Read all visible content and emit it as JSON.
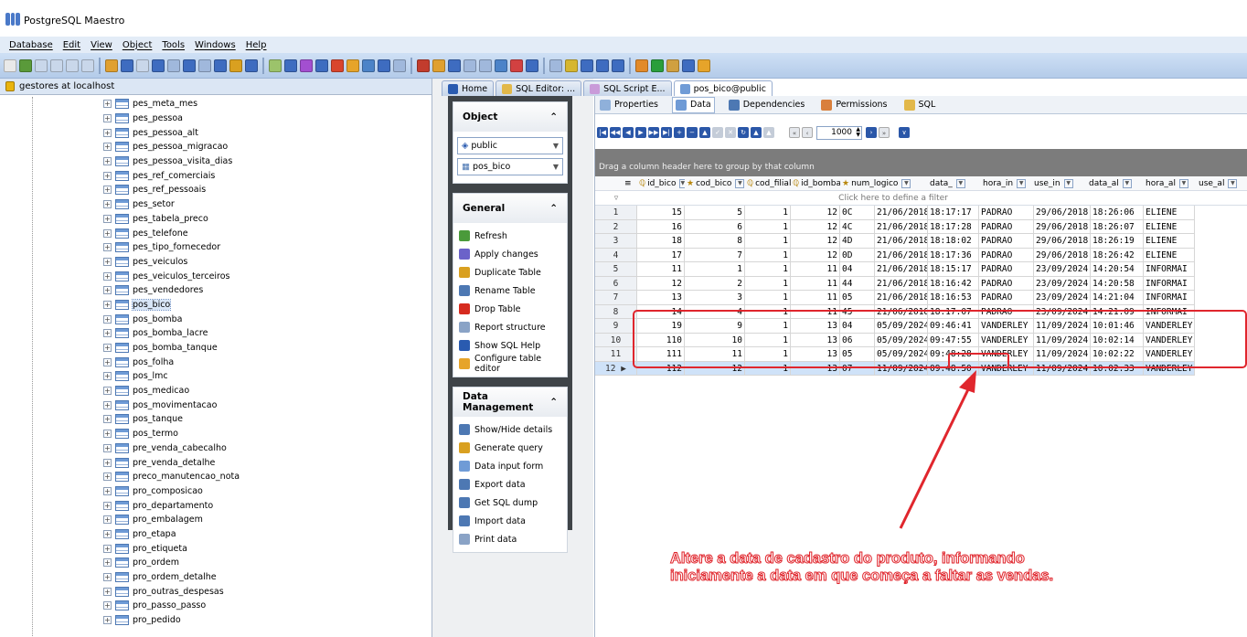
{
  "app": {
    "title": "PostgreSQL Maestro"
  },
  "menu": [
    "Database",
    "Edit",
    "View",
    "Object",
    "Tools",
    "Windows",
    "Help"
  ],
  "explorer": {
    "connection": "gestores at localhost",
    "tables": [
      "pes_meta_mes",
      "pes_pessoa",
      "pes_pessoa_alt",
      "pes_pessoa_migracao",
      "pes_pessoa_visita_dias",
      "pes_ref_comerciais",
      "pes_ref_pessoais",
      "pes_setor",
      "pes_tabela_preco",
      "pes_telefone",
      "pes_tipo_fornecedor",
      "pes_veiculos",
      "pes_veiculos_terceiros",
      "pes_vendedores",
      "pos_bico",
      "pos_bomba",
      "pos_bomba_lacre",
      "pos_bomba_tanque",
      "pos_folha",
      "pos_lmc",
      "pos_medicao",
      "pos_movimentacao",
      "pos_tanque",
      "pos_termo",
      "pre_venda_cabecalho",
      "pre_venda_detalhe",
      "preco_manutencao_nota",
      "pro_composicao",
      "pro_departamento",
      "pro_embalagem",
      "pro_etapa",
      "pro_etiqueta",
      "pro_ordem",
      "pro_ordem_detalhe",
      "pro_outras_despesas",
      "pro_passo_passo",
      "pro_pedido"
    ],
    "selected": "pos_bico"
  },
  "tabs": [
    "Home",
    "SQL Editor: ...",
    "SQL Script E...",
    "pos_bico@public"
  ],
  "object_panel": {
    "object_title": "Object",
    "schema": "public",
    "table": "pos_bico",
    "general_title": "General",
    "general_actions": [
      "Refresh",
      "Apply changes",
      "Duplicate Table",
      "Rename Table",
      "Drop Table",
      "Report structure",
      "Show SQL Help",
      "Configure table editor"
    ],
    "data_title": "Data Management",
    "data_actions": [
      "Show/Hide details",
      "Generate query",
      "Data input form",
      "Export data",
      "Get SQL dump",
      "Import data",
      "Print data"
    ]
  },
  "subtabs": [
    "Properties",
    "Data",
    "Dependencies",
    "Permissions",
    "SQL"
  ],
  "navigator": {
    "limit": "1000"
  },
  "grid": {
    "group_hint": "Drag a column header here to group by that column",
    "filter_hint": "Click here to define a filter",
    "columns": [
      "id_bico",
      "cod_bico",
      "cod_filial",
      "id_bomba",
      "num_logico",
      "data_",
      "hora_in",
      "use_in",
      "data_al",
      "hora_al",
      "use_al"
    ],
    "rows": [
      [
        "1",
        "15",
        "5",
        "1",
        "12",
        "0C",
        "21/06/2018",
        "18:17:17",
        "PADRAO",
        "29/06/2018",
        "18:26:06",
        "ELIENE"
      ],
      [
        "2",
        "16",
        "6",
        "1",
        "12",
        "4C",
        "21/06/2018",
        "18:17:28",
        "PADRAO",
        "29/06/2018",
        "18:26:07",
        "ELIENE"
      ],
      [
        "3",
        "18",
        "8",
        "1",
        "12",
        "4D",
        "21/06/2018",
        "18:18:02",
        "PADRAO",
        "29/06/2018",
        "18:26:19",
        "ELIENE"
      ],
      [
        "4",
        "17",
        "7",
        "1",
        "12",
        "0D",
        "21/06/2018",
        "18:17:36",
        "PADRAO",
        "29/06/2018",
        "18:26:42",
        "ELIENE"
      ],
      [
        "5",
        "11",
        "1",
        "1",
        "11",
        "04",
        "21/06/2018",
        "18:15:17",
        "PADRAO",
        "23/09/2024",
        "14:20:54",
        "INFORMAI"
      ],
      [
        "6",
        "12",
        "2",
        "1",
        "11",
        "44",
        "21/06/2018",
        "18:16:42",
        "PADRAO",
        "23/09/2024",
        "14:20:58",
        "INFORMAI"
      ],
      [
        "7",
        "13",
        "3",
        "1",
        "11",
        "05",
        "21/06/2018",
        "18:16:53",
        "PADRAO",
        "23/09/2024",
        "14:21:04",
        "INFORMAI"
      ],
      [
        "8",
        "14",
        "4",
        "1",
        "11",
        "45",
        "21/06/2018",
        "18:17:07",
        "PADRAO",
        "23/09/2024",
        "14:21:09",
        "INFORMAI"
      ],
      [
        "9",
        "19",
        "9",
        "1",
        "13",
        "04",
        "05/09/2024",
        "09:46:41",
        "VANDERLEY",
        "11/09/2024",
        "10:01:46",
        "VANDERLEY"
      ],
      [
        "10",
        "110",
        "10",
        "1",
        "13",
        "06",
        "05/09/2024",
        "09:47:55",
        "VANDERLEY",
        "11/09/2024",
        "10:02:14",
        "VANDERLEY"
      ],
      [
        "11",
        "111",
        "11",
        "1",
        "13",
        "05",
        "05/09/2024",
        "09:48:28",
        "VANDERLEY",
        "11/09/2024",
        "10:02:22",
        "VANDERLEY"
      ],
      [
        "12",
        "112",
        "12",
        "1",
        "13",
        "07",
        "11/09/2024",
        "09:48:50",
        "VANDERLEY",
        "11/09/2024",
        "10:02:33",
        "VANDERLEY"
      ]
    ]
  },
  "annotation": {
    "line1": "Altere a data de cadastro do produto, informando",
    "line2": "iniciamente a data em que começa a faltar as vendas."
  },
  "colors": {
    "accent_red": "#e0262d",
    "toolbar_blue": "#b4cbe9"
  }
}
